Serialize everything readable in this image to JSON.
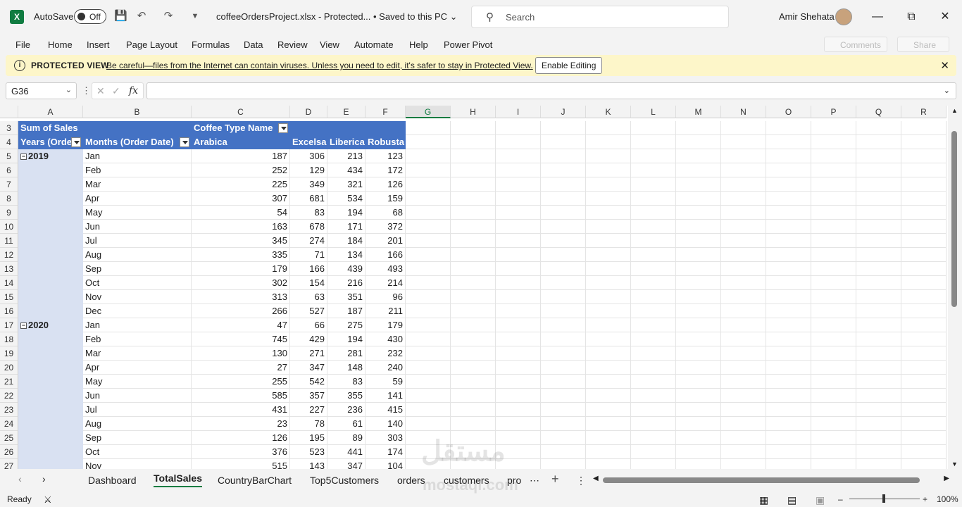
{
  "titlebar": {
    "autosave_label": "AutoSave",
    "autosave_state": "Off",
    "filename": "coffeeOrdersProject.xlsx  -  Protected...   • Saved to this PC ⌄",
    "search_placeholder": "Search",
    "user_name": "Amir Shehata"
  },
  "menu": [
    "File",
    "Home",
    "Insert",
    "Page Layout",
    "Formulas",
    "Data",
    "Review",
    "View",
    "Automate",
    "Help",
    "Power Pivot"
  ],
  "menu_right": {
    "comments": "Comments",
    "share": "Share"
  },
  "protected": {
    "title": "PROTECTED VIEW",
    "message": "Be careful—files from the Internet can contain viruses. Unless you need to edit, it's safer to stay in Protected View.",
    "button": "Enable Editing"
  },
  "formula_bar": {
    "name_box": "G36",
    "fx": "fx",
    "formula": ""
  },
  "columns": [
    "A",
    "B",
    "C",
    "D",
    "E",
    "F",
    "G",
    "H",
    "I",
    "J",
    "K",
    "L",
    "M",
    "N",
    "O",
    "P",
    "Q",
    "R"
  ],
  "selected_column": "G",
  "pivot": {
    "sum_label": "Sum of Sales",
    "col_field": "Coffee Type Name",
    "row_field_years": "Years (Orde",
    "row_field_months": "Months (Order Date)",
    "types": [
      "Arabica",
      "Excelsa",
      "Liberica",
      "Robusta"
    ],
    "rows": [
      {
        "row": "5",
        "year": "2019",
        "month": "Jan",
        "v": [
          "187",
          "306",
          "213",
          "123"
        ]
      },
      {
        "row": "6",
        "year": "",
        "month": "Feb",
        "v": [
          "252",
          "129",
          "434",
          "172"
        ]
      },
      {
        "row": "7",
        "year": "",
        "month": "Mar",
        "v": [
          "225",
          "349",
          "321",
          "126"
        ]
      },
      {
        "row": "8",
        "year": "",
        "month": "Apr",
        "v": [
          "307",
          "681",
          "534",
          "159"
        ]
      },
      {
        "row": "9",
        "year": "",
        "month": "May",
        "v": [
          "54",
          "83",
          "194",
          "68"
        ]
      },
      {
        "row": "10",
        "year": "",
        "month": "Jun",
        "v": [
          "163",
          "678",
          "171",
          "372"
        ]
      },
      {
        "row": "11",
        "year": "",
        "month": "Jul",
        "v": [
          "345",
          "274",
          "184",
          "201"
        ]
      },
      {
        "row": "12",
        "year": "",
        "month": "Aug",
        "v": [
          "335",
          "71",
          "134",
          "166"
        ]
      },
      {
        "row": "13",
        "year": "",
        "month": "Sep",
        "v": [
          "179",
          "166",
          "439",
          "493"
        ]
      },
      {
        "row": "14",
        "year": "",
        "month": "Oct",
        "v": [
          "302",
          "154",
          "216",
          "214"
        ]
      },
      {
        "row": "15",
        "year": "",
        "month": "Nov",
        "v": [
          "313",
          "63",
          "351",
          "96"
        ]
      },
      {
        "row": "16",
        "year": "",
        "month": "Dec",
        "v": [
          "266",
          "527",
          "187",
          "211"
        ]
      },
      {
        "row": "17",
        "year": "2020",
        "month": "Jan",
        "v": [
          "47",
          "66",
          "275",
          "179"
        ]
      },
      {
        "row": "18",
        "year": "",
        "month": "Feb",
        "v": [
          "745",
          "429",
          "194",
          "430"
        ]
      },
      {
        "row": "19",
        "year": "",
        "month": "Mar",
        "v": [
          "130",
          "271",
          "281",
          "232"
        ]
      },
      {
        "row": "20",
        "year": "",
        "month": "Apr",
        "v": [
          "27",
          "347",
          "148",
          "240"
        ]
      },
      {
        "row": "21",
        "year": "",
        "month": "May",
        "v": [
          "255",
          "542",
          "83",
          "59"
        ]
      },
      {
        "row": "22",
        "year": "",
        "month": "Jun",
        "v": [
          "585",
          "357",
          "355",
          "141"
        ]
      },
      {
        "row": "23",
        "year": "",
        "month": "Jul",
        "v": [
          "431",
          "227",
          "236",
          "415"
        ]
      },
      {
        "row": "24",
        "year": "",
        "month": "Aug",
        "v": [
          "23",
          "78",
          "61",
          "140"
        ]
      },
      {
        "row": "25",
        "year": "",
        "month": "Sep",
        "v": [
          "126",
          "195",
          "89",
          "303"
        ]
      },
      {
        "row": "26",
        "year": "",
        "month": "Oct",
        "v": [
          "376",
          "523",
          "441",
          "174"
        ]
      },
      {
        "row": "27",
        "year": "",
        "month": "Nov",
        "v": [
          "515",
          "143",
          "347",
          "104"
        ]
      }
    ]
  },
  "sheet_tabs": [
    "Dashboard",
    "TotalSales",
    "CountryBarChart",
    "Top5Customers",
    "orders",
    "customers",
    "pro"
  ],
  "active_tab": "TotalSales",
  "status": {
    "ready": "Ready",
    "zoom": "100%"
  },
  "watermark": {
    "main": "مستقل",
    "sub": "mostaql.com"
  }
}
